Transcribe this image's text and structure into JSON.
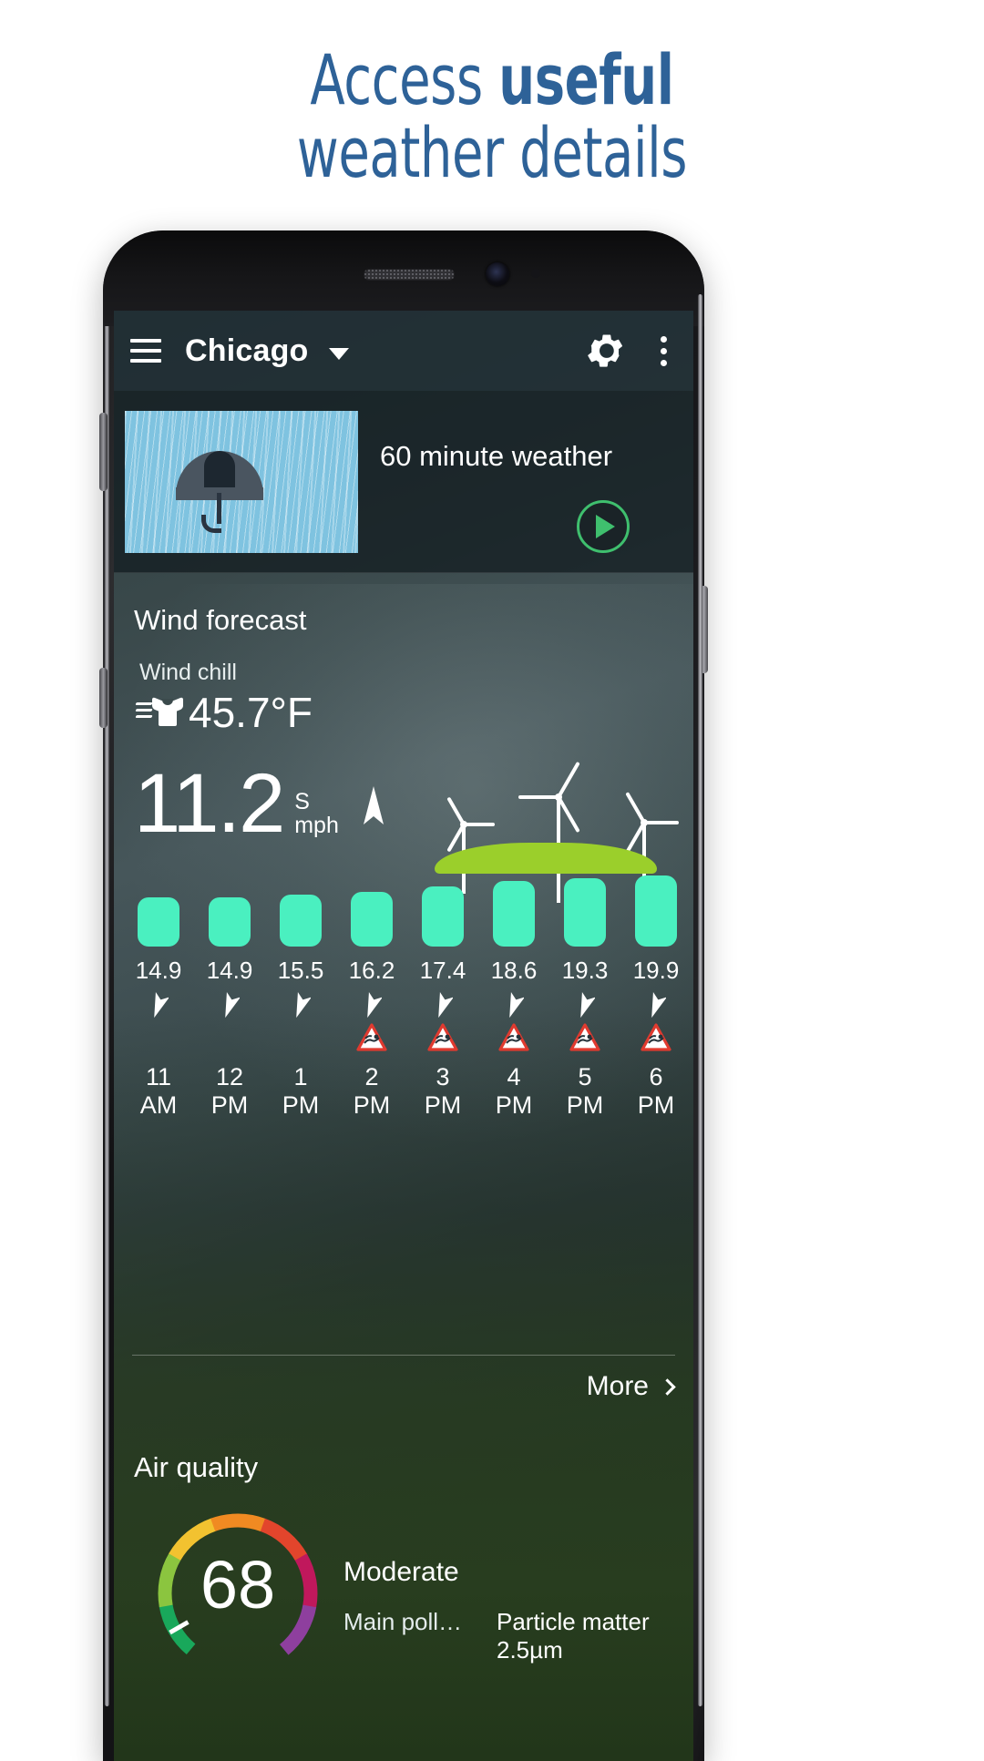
{
  "headline": {
    "line1_regular": "Access ",
    "line1_bold": "useful",
    "line2": "weather details",
    "color": "#2e6298"
  },
  "appbar": {
    "menu_icon": "hamburger-menu-icon",
    "city": "Chicago",
    "dropdown_icon": "chevron-down-icon",
    "settings_icon": "gear-icon",
    "overflow_icon": "more-vertical-icon"
  },
  "card60": {
    "title": "60 minute weather",
    "thumbnail_icon": "umbrella-rain-icon",
    "play_icon": "play-icon",
    "play_color": "#3fbf6e"
  },
  "wind": {
    "section_title": "Wind forecast",
    "chill_label": "Wind chill",
    "chill_icon": "wind-tshirt-icon",
    "chill_value": "45.7°F",
    "speed_value": "11.2",
    "direction": "S",
    "unit": "mph",
    "direction_arrow_icon": "wind-direction-arrow-icon",
    "turbine_icon": "wind-turbine-icon",
    "hill_color": "#9bcf2b",
    "more_label": "More",
    "more_icon": "chevron-right-icon"
  },
  "chart_data": {
    "type": "bar",
    "title": "Wind forecast",
    "categories": [
      "11 AM",
      "12 PM",
      "1 PM",
      "2 PM",
      "3 PM",
      "4 PM",
      "5 PM",
      "6 PM"
    ],
    "values": [
      14.9,
      14.9,
      15.5,
      16.2,
      17.4,
      18.6,
      19.3,
      19.9
    ],
    "value_labels": [
      "14.9",
      "14.9",
      "15.5",
      "16.2",
      "17.4",
      "18.6",
      "19.3",
      "19.9"
    ],
    "time_lines": [
      [
        "11",
        "AM"
      ],
      [
        "12",
        "PM"
      ],
      [
        "1",
        "PM"
      ],
      [
        "2",
        "PM"
      ],
      [
        "3",
        "PM"
      ],
      [
        "4",
        "PM"
      ],
      [
        "5",
        "PM"
      ],
      [
        "6",
        "PM"
      ]
    ],
    "warnings": [
      false,
      false,
      false,
      true,
      true,
      true,
      true,
      true
    ],
    "arrow_icon": "wind-direction-arrow-icon",
    "warning_icon": "wind-warning-triangle-icon",
    "bar_color": "#4af0c0",
    "ylabel": "mph",
    "xlabel": "",
    "ylim": [
      0,
      22
    ],
    "grid": false,
    "legend": "none"
  },
  "air_quality": {
    "title": "Air quality",
    "index": "68",
    "category": "Moderate",
    "pollutant_label": "Main poll…",
    "pollutant_value": "Particle matter 2.5µm",
    "gauge_colors": [
      "#19a85b",
      "#8bc53f",
      "#f2c230",
      "#f08a22",
      "#e2452c",
      "#c0185c",
      "#8e3f9e"
    ]
  }
}
